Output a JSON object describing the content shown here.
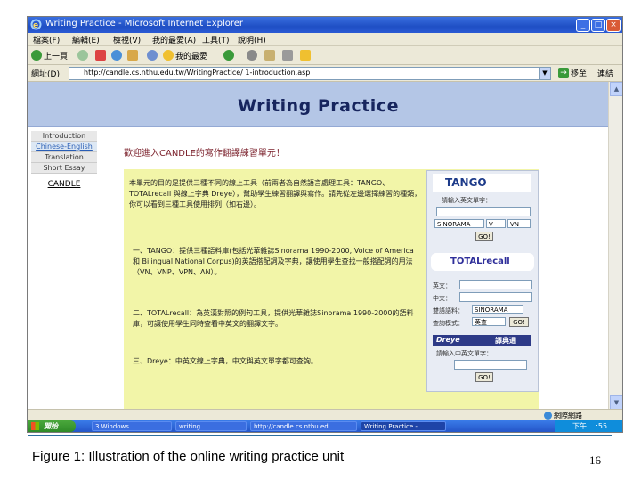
{
  "window": {
    "title": "Writing Practice - Microsoft Internet Explorer",
    "menu": [
      "檔案(F)",
      "編輯(E)",
      "檢視(V)",
      "我的最愛(A)",
      "工具(T)",
      "說明(H)"
    ],
    "toolbar": {
      "back": "上一頁",
      "favorites": "我的最愛"
    },
    "address_label": "網址(D)",
    "address_value": "http://candle.cs.nthu.edu.tw/WritingPractice/ 1-introduction.asp",
    "go_label": "移至",
    "links_label": "連結"
  },
  "page": {
    "banner_title": "Writing Practice",
    "nav": [
      {
        "label": "Introduction"
      },
      {
        "label": "Chinese-English"
      },
      {
        "label": "Translation"
      },
      {
        "label": "Short Essay"
      }
    ],
    "nav_candle": "CANDLE",
    "welcome": "歡迎進入CANDLE的寫作翻譯練習單元！",
    "paragraphs": [
      "本單元的目的是提供三種不同的線上工具（前兩者為自然語言處理工具：TANGO、TOTALrecall 與線上字典 Dreye），幫助學生練習翻譯與寫作。請先從左邊選擇練習的種類，你可以看到三種工具使用排列（如右邊）。",
      "一、TANGO：提供三種語料庫(包括光華雜誌Sinorama 1990-2000, Voice of America和 Bilingual National Corpus)的英語搭配詞及字典，讓使用學生查找一般搭配詞的用法（VN、VNP、VPN、AN）。",
      "二、TOTALrecall：為英漢對照的例句工具，提供光華雜誌Sinorama 1990-2000的語料庫，可讓使用學生同時查看中英文的翻譯文字。",
      "三、Dreye：中英文線上字典，中文與英文單字都可查詢。"
    ],
    "tango": {
      "logo": "TANGO",
      "query_label": "請輸入英文單字：",
      "corpus": "SINORAMA",
      "pos1": "V",
      "pos2": "VN",
      "button": "GO!"
    },
    "totalrecall": {
      "logo": "TOTALrecall",
      "english_label": "英文：",
      "chinese_label": "中文：",
      "corpus_label": "雙語語料：",
      "corpus": "SINORAMA",
      "mode_label": "查詢模式：",
      "mode": "英查",
      "button": "GO!"
    },
    "dreye": {
      "logo": "Dreye",
      "logo_sub": "譯典通",
      "query_label": "請輸入中英文單字：",
      "button": "GO!"
    }
  },
  "statusbar": {
    "zone": "網際網路"
  },
  "taskbar": {
    "start": "開始",
    "tasks": [
      "3 Windows...",
      "writing",
      "http://candle.cs.nthu.ed...",
      "Writing Practice - ..."
    ],
    "clock": "下午 ...:55"
  },
  "caption": "Figure 1: Illustration of the online writing practice unit",
  "page_number": "16"
}
